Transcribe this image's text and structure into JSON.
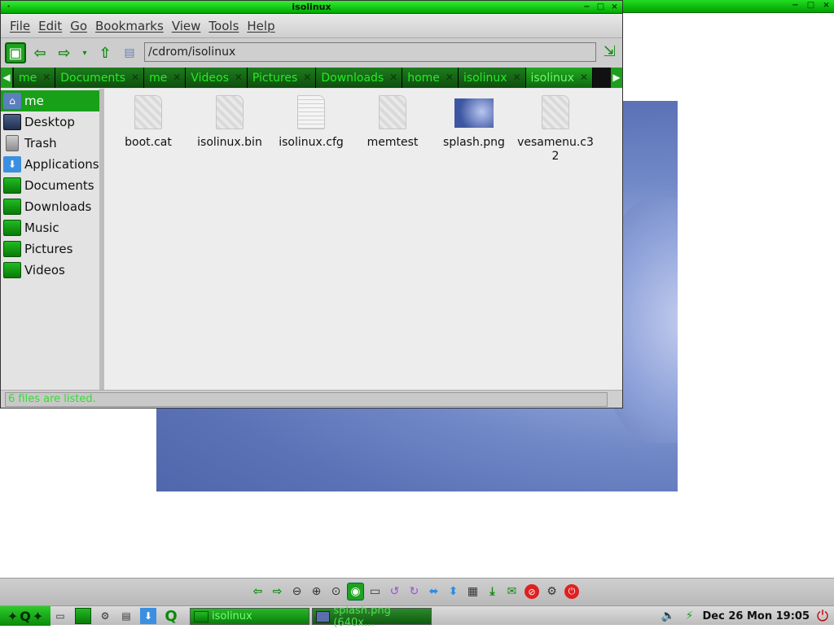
{
  "background_window": {
    "buttons": [
      "−",
      "□",
      "×"
    ]
  },
  "window": {
    "title": "isolinux",
    "buttons": [
      "−",
      "□",
      "×"
    ]
  },
  "menubar": {
    "items": [
      "File",
      "Edit",
      "Go",
      "Bookmarks",
      "View",
      "Tools",
      "Help"
    ]
  },
  "toolbar": {
    "location": "/cdrom/isolinux"
  },
  "pathbar": {
    "crumbs": [
      "me",
      "Documents",
      "me",
      "Videos",
      "Pictures",
      "Downloads",
      "home",
      "isolinux",
      "isolinux"
    ],
    "active_index": 8
  },
  "sidebar": {
    "items": [
      {
        "label": "me",
        "icon": "home-icon"
      },
      {
        "label": "Desktop",
        "icon": "desktop-icon"
      },
      {
        "label": "Trash",
        "icon": "trash-icon"
      },
      {
        "label": "Applications",
        "icon": "applications-icon"
      },
      {
        "label": "Documents",
        "icon": "folder-icon"
      },
      {
        "label": "Downloads",
        "icon": "folder-icon"
      },
      {
        "label": "Music",
        "icon": "folder-icon"
      },
      {
        "label": "Pictures",
        "icon": "folder-icon"
      },
      {
        "label": "Videos",
        "icon": "folder-icon"
      }
    ],
    "selected_index": 0
  },
  "files": [
    {
      "name": "boot.cat",
      "icon": "generic-file-icon"
    },
    {
      "name": "isolinux.bin",
      "icon": "generic-file-icon"
    },
    {
      "name": "isolinux.cfg",
      "icon": "text-file-icon"
    },
    {
      "name": "memtest",
      "icon": "generic-file-icon"
    },
    {
      "name": "splash.png",
      "icon": "image-thumbnail-icon"
    },
    {
      "name": "vesamenu.c32",
      "icon": "generic-file-icon"
    }
  ],
  "status": {
    "text": "6 files are listed."
  },
  "taskbar": {
    "tasks": [
      {
        "label": "isolinux",
        "icon": "folder-icon"
      },
      {
        "label": "splash.png (640x...",
        "icon": "image-icon"
      }
    ],
    "clock": "Dec 26 Mon 19:05"
  },
  "colors": {
    "accent": "#1ea31e",
    "selection": "#19a019",
    "status_text": "#33dd33"
  }
}
